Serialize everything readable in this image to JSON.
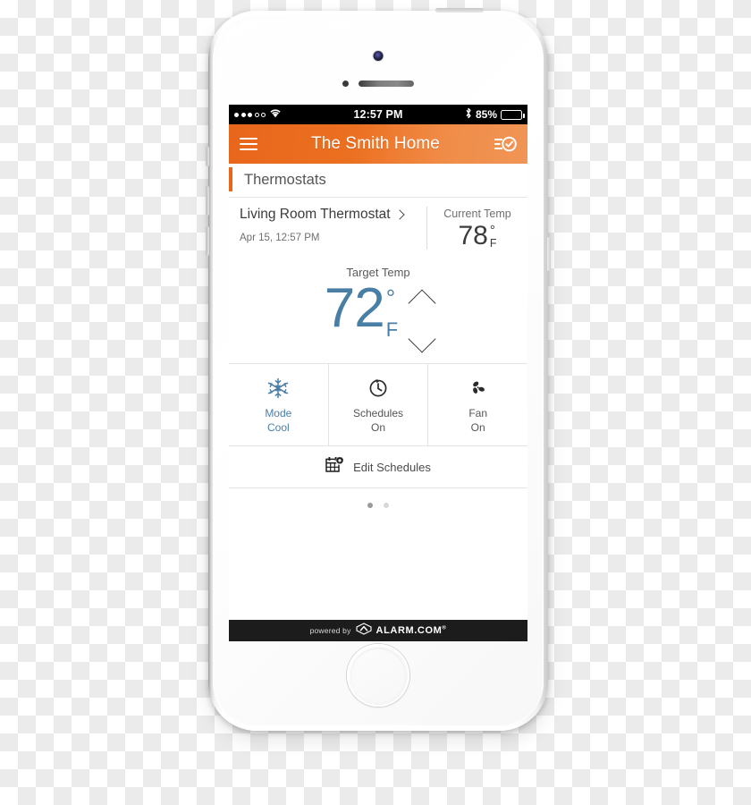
{
  "device": {
    "kind": "iphone-5s-white-silver"
  },
  "status_bar": {
    "signal_dots_filled": 3,
    "signal_dots_empty": 2,
    "wifi_icon": "wifi-icon",
    "time": "12:57 PM",
    "bluetooth_icon": "bluetooth-icon",
    "battery_percent": "85%",
    "battery_level": 85
  },
  "header": {
    "menu_icon": "hamburger-menu-icon",
    "title": "The Smith Home",
    "action_icon": "checklist-check-icon",
    "accent_color": "#e8661c"
  },
  "section": {
    "title": "Thermostats",
    "accent_color": "#e8661c"
  },
  "thermostat": {
    "name": "Living Room Thermostat",
    "chevron_icon": "chevron-right-icon",
    "timestamp": "Apr 15, 12:57 PM",
    "current": {
      "label": "Current Temp",
      "value": "78",
      "degree": "°",
      "unit": "F"
    },
    "target": {
      "label": "Target Temp",
      "value": "72",
      "degree": "°",
      "unit": "F",
      "color": "#4a7fa5",
      "increase_icon": "chevron-up-icon",
      "decrease_icon": "chevron-down-icon"
    }
  },
  "controls": [
    {
      "id": "mode",
      "icon": "snowflake-icon",
      "label": "Mode",
      "value": "Cool",
      "active": true,
      "color": "#4a7fa5"
    },
    {
      "id": "schedules",
      "icon": "clock-refresh-icon",
      "label": "Schedules",
      "value": "On",
      "active": false,
      "color": "#2b2b2b"
    },
    {
      "id": "fan",
      "icon": "fan-blades-icon",
      "label": "Fan",
      "value": "On",
      "active": false,
      "color": "#2b2b2b"
    }
  ],
  "edit_schedules": {
    "icon": "calendar-gear-icon",
    "label": "Edit Schedules"
  },
  "pagination": {
    "total": 2,
    "active_index": 0
  },
  "footer": {
    "powered_by": "powered by",
    "brand": "ALARM.COM",
    "registered_mark": "®",
    "logo_icon": "alarm-dot-com-chevron-logo"
  }
}
